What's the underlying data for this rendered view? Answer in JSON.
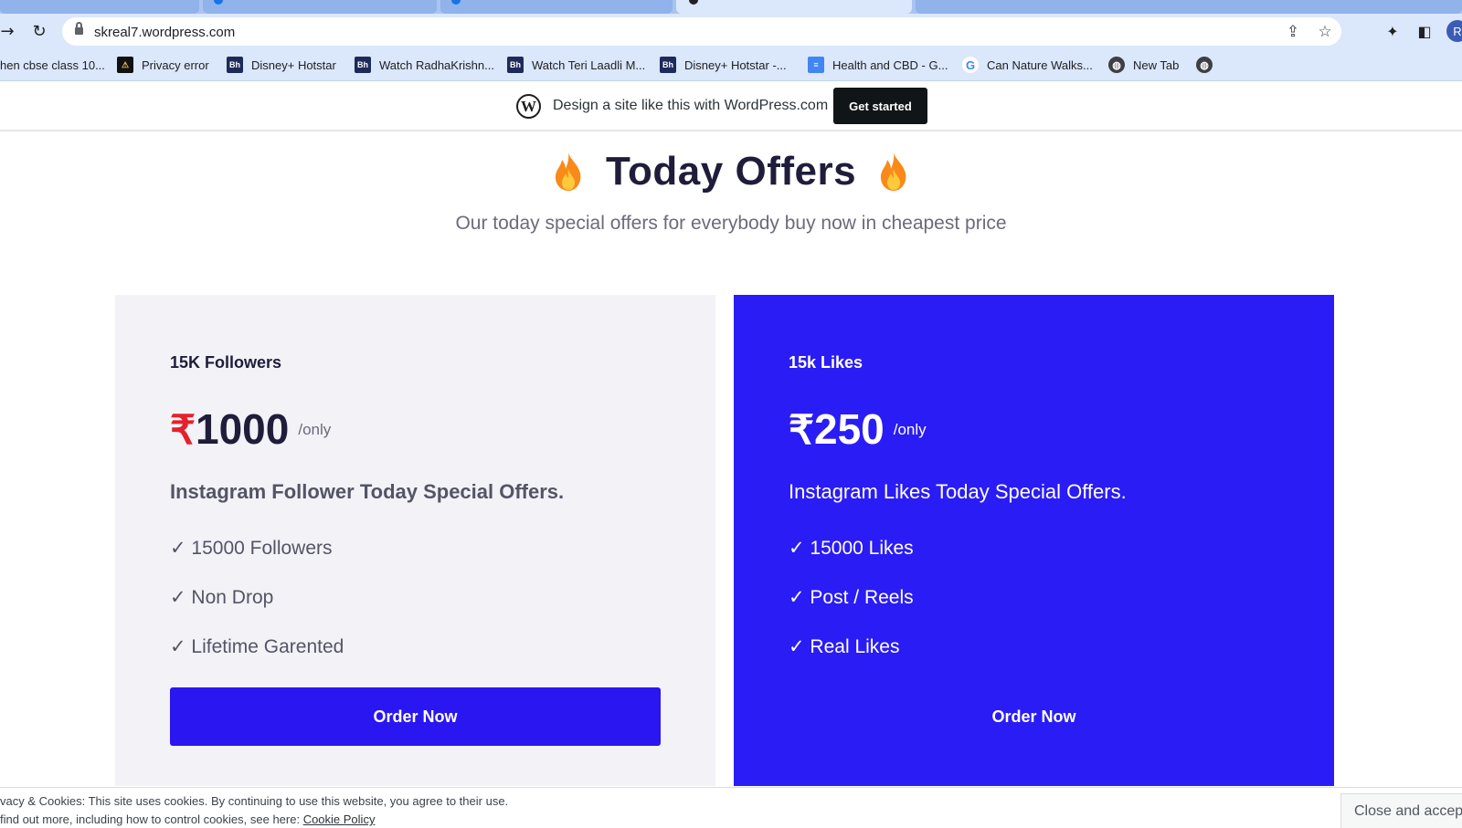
{
  "browser": {
    "url": "skreal7.wordpress.com",
    "avatar_initial": "R",
    "bookmarks": [
      {
        "label": "hen cbse class 10...",
        "icon": "none"
      },
      {
        "label": "Privacy error",
        "icon": "privacy-error-icon"
      },
      {
        "label": "Disney+ Hotstar",
        "icon": "bh-site-icon"
      },
      {
        "label": "Watch RadhaKrishn...",
        "icon": "bh-site-icon"
      },
      {
        "label": "Watch Teri Laadli M...",
        "icon": "bh-site-icon"
      },
      {
        "label": "Disney+ Hotstar -...",
        "icon": "bh-site-icon"
      },
      {
        "label": "Health and CBD - G...",
        "icon": "google-docs-icon"
      },
      {
        "label": "Can Nature Walks...",
        "icon": "google-icon"
      },
      {
        "label": "New Tab",
        "icon": "globe-icon"
      }
    ]
  },
  "wp_banner": {
    "text": "Design a site like this with WordPress.com",
    "cta": "Get started"
  },
  "page": {
    "title": "Today Offers",
    "subtitle": "Our today special offers for everybody buy now in cheapest price"
  },
  "offers": [
    {
      "name": "15K Followers",
      "currency": "₹",
      "price": "1000",
      "per": "/only",
      "description": "Instagram Follower Today Special Offers.",
      "features": [
        "✓ 15000 Followers",
        "✓ Non Drop",
        "✓ Lifetime Garented"
      ],
      "button": "Order Now"
    },
    {
      "name": "15k Likes",
      "currency": "₹",
      "price": "250",
      "per": "/only",
      "description": "Instagram Likes Today Special Offers.",
      "features": [
        "✓ 15000 Likes",
        "✓ Post / Reels",
        "✓ Real Likes"
      ],
      "button": "Order Now"
    }
  ],
  "cookie": {
    "line1": "vacy & Cookies: This site uses cookies. By continuing to use this website, you agree to their use.",
    "line2_prefix": "find out more, including how to control cookies, see here: ",
    "link": "Cookie Policy",
    "button": "Close and accept"
  },
  "colors": {
    "accent_blue": "#2a1cf5",
    "rupee_red": "#e5212a",
    "flame_orange": "#f98a1a"
  }
}
